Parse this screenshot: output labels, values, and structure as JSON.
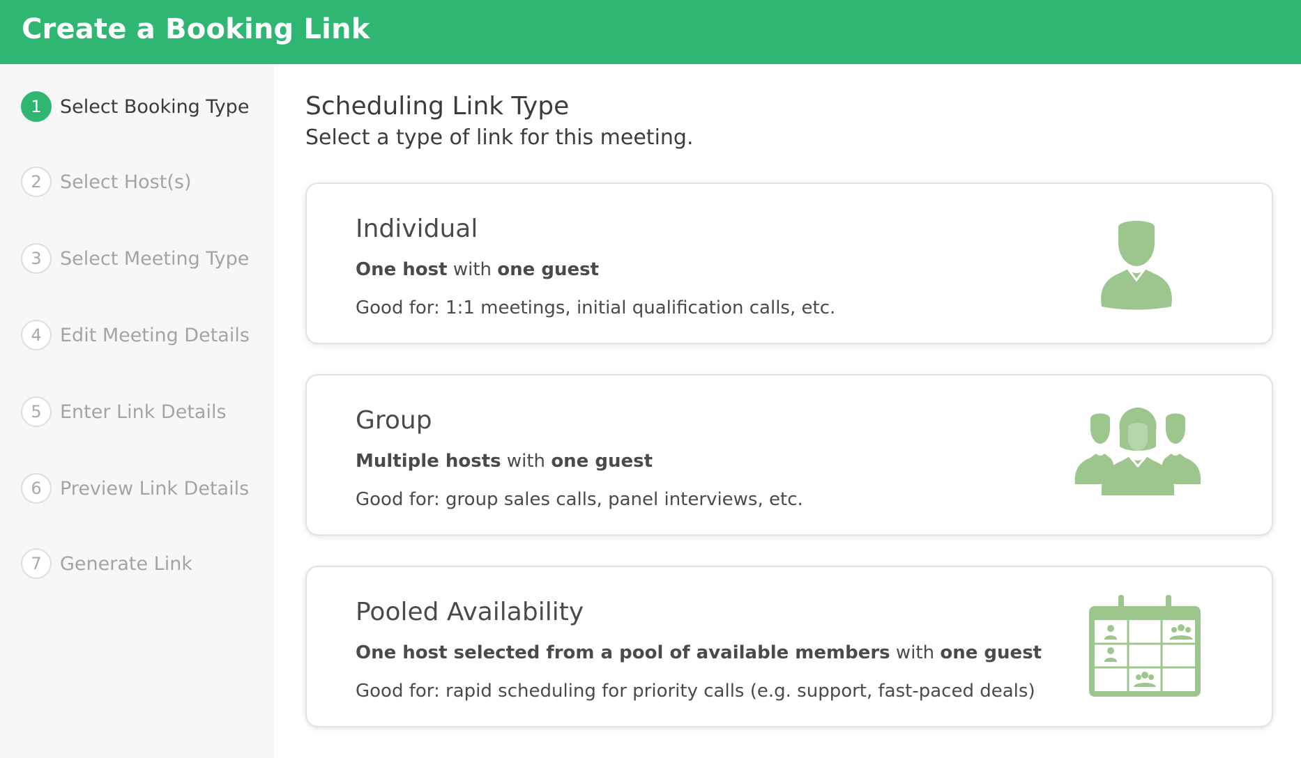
{
  "header": {
    "title": "Create a Booking Link"
  },
  "colors": {
    "accent": "#2fb673",
    "icon": "#9cc68e"
  },
  "steps": [
    {
      "num": "1",
      "label": "Select Booking Type",
      "active": true
    },
    {
      "num": "2",
      "label": "Select Host(s)"
    },
    {
      "num": "3",
      "label": "Select Meeting Type"
    },
    {
      "num": "4",
      "label": "Edit Meeting Details"
    },
    {
      "num": "5",
      "label": "Enter Link Details"
    },
    {
      "num": "6",
      "label": "Preview Link Details"
    },
    {
      "num": "7",
      "label": "Generate Link"
    }
  ],
  "main": {
    "title": "Scheduling Link Type",
    "subtitle": "Select a type of link for this meeting."
  },
  "cards": [
    {
      "title": "Individual",
      "desc_bold1": "One host",
      "desc_mid": " with ",
      "desc_bold2": "one guest",
      "good_for": "Good for: 1:1 meetings, initial qualification calls, etc.",
      "icon": "single-person-icon"
    },
    {
      "title": "Group",
      "desc_bold1": "Multiple hosts",
      "desc_mid": " with ",
      "desc_bold2": "one guest",
      "good_for": "Good for: group sales calls, panel interviews, etc.",
      "icon": "group-people-icon"
    },
    {
      "title": "Pooled Availability",
      "desc_bold1": "One host selected from a pool of available members",
      "desc_mid": " with ",
      "desc_bold2": "one guest",
      "good_for": "Good for: rapid scheduling for priority calls (e.g. support, fast-paced deals)",
      "icon": "calendar-pool-icon"
    }
  ]
}
